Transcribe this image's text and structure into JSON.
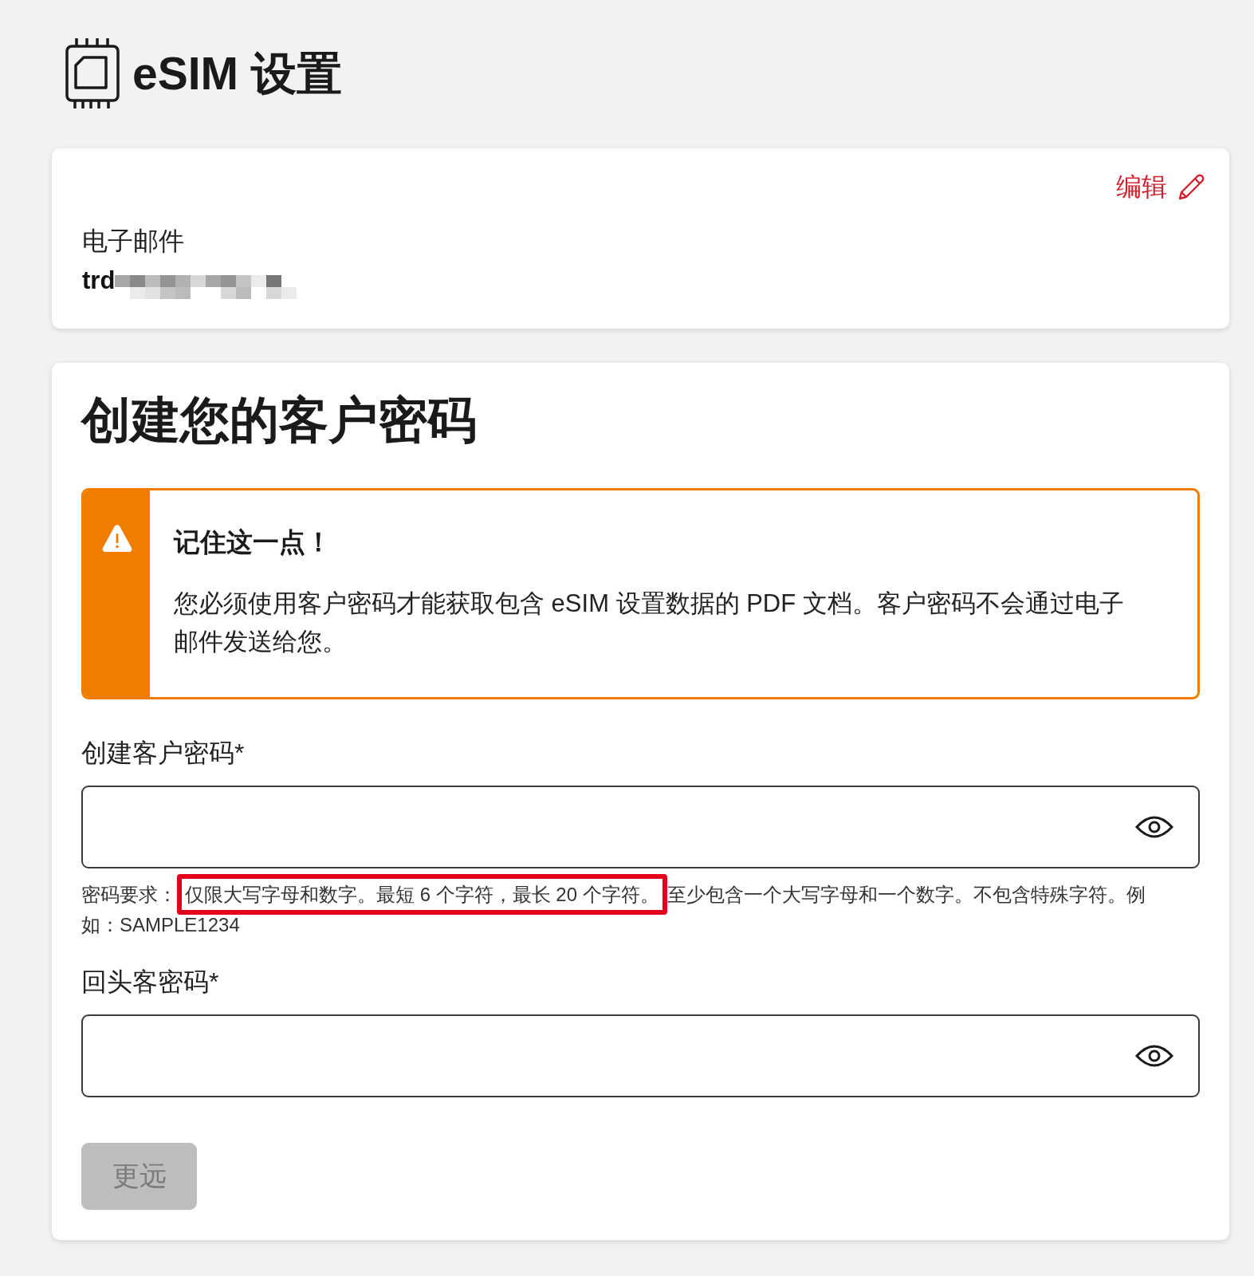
{
  "header": {
    "title": "eSIM 设置"
  },
  "account_card": {
    "edit_link": "编辑",
    "email": {
      "label": "电子邮件",
      "value": "trd",
      "redacted": true
    }
  },
  "password_card": {
    "heading": "创建您的客户密码",
    "notice": {
      "kind": "warning",
      "title": "记住这一点！",
      "text": "您必须使用客户密码才能获取包含 eSIM 设置数据的 PDF 文档。客户密码不会通过电子邮件发送给您。"
    },
    "fields": [
      {
        "label": "创建客户密码*",
        "hint": [
          {
            "text": "密码要求：",
            "highlighted": false
          },
          {
            "text": "仅限大写字母和数字。最短 6 个字符，最长 20 个字符。",
            "highlighted": true
          },
          {
            "text": "至少包含一个大写字母和一个数字。不包含特殊字符。例如：SAMPLE1234",
            "highlighted": false
          }
        ]
      },
      {
        "label": "回头客密码*"
      }
    ],
    "submit": {
      "label": "更远",
      "disabled": true
    }
  }
}
